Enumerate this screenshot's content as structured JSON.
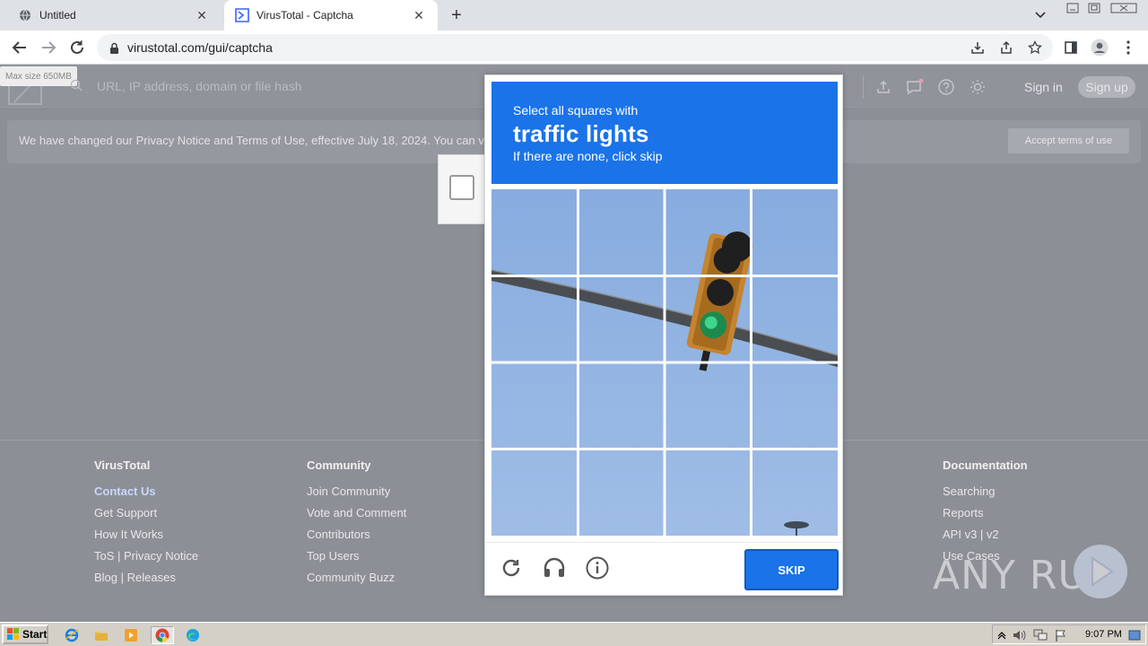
{
  "browser": {
    "tabs": [
      {
        "title": "Untitled",
        "active": false,
        "favicon": "globe-icon"
      },
      {
        "title": "VirusTotal - Captcha",
        "active": true,
        "favicon": "virustotal-icon"
      }
    ],
    "url": "virustotal.com/gui/captcha"
  },
  "vt": {
    "maxsize_label": "Max size 650MB",
    "search_placeholder": "URL, IP address, domain or file hash",
    "signin_label": "Sign in",
    "signup_label": "Sign up",
    "notice_text": "We have changed our Privacy Notice and Terms of Use, effective July 18, 2024. You can v",
    "accept_label": "Accept terms of use"
  },
  "footer": {
    "col1": {
      "heading": "VirusTotal",
      "links": [
        "Contact Us",
        "Get Support",
        "How It Works",
        "ToS | Privacy Notice",
        "Blog | Releases"
      ]
    },
    "col2": {
      "heading": "Community",
      "links": [
        "Join Community",
        "Vote and Comment",
        "Contributors",
        "Top Users",
        "Community Buzz"
      ]
    },
    "col3": {
      "heading": "Documentation",
      "links": [
        "Searching",
        "Reports",
        "API v3 | v2",
        "Use Cases"
      ]
    }
  },
  "captcha": {
    "line1": "Select all squares with",
    "target": "traffic lights",
    "line3": "If there are none, click skip",
    "skip_label": "SKIP",
    "header_color": "#1a73e8"
  },
  "watermark": {
    "text": "ANY RUN"
  },
  "taskbar": {
    "start_label": "Start",
    "clock": "9:07 PM"
  }
}
